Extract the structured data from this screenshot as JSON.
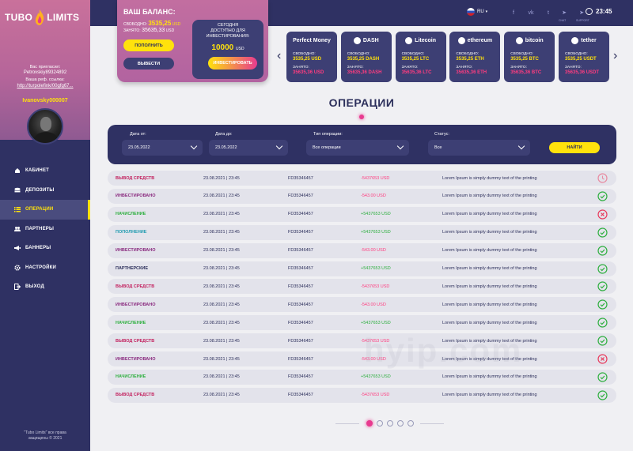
{
  "brand": {
    "name_left": "TUBO",
    "name_right": "LIMITS"
  },
  "colors": {
    "sidebar": "#2f3163",
    "accent_yellow": "#ffe20c",
    "accent_pink": "#e83a8f",
    "positive": "#2eaf3f",
    "negative": "#ff3c7f",
    "card": "#3d3f74"
  },
  "sidebar": {
    "invite_label": "Вас пригласил:",
    "inviter": "Petrovskiy89324892",
    "ref_label": "Ваша реф. ссылка:",
    "ref_link": "http://turpolefink/00gfg67...",
    "username": "Ivanovsky000007",
    "menu": [
      {
        "label": "КАБИНЕТ",
        "icon": "home-icon",
        "active": false
      },
      {
        "label": "ДЕПОЗИТЫ",
        "icon": "coins-icon",
        "active": false
      },
      {
        "label": "ОПЕРАЦИИ",
        "icon": "list-icon",
        "active": true
      },
      {
        "label": "ПАРТНЕРЫ",
        "icon": "users-icon",
        "active": false
      },
      {
        "label": "БАННЕРЫ",
        "icon": "megaphone-icon",
        "active": false
      },
      {
        "label": "НАСТРОЙКИ",
        "icon": "gear-icon",
        "active": false
      },
      {
        "label": "ВЫХОД",
        "icon": "logout-icon",
        "active": false
      }
    ],
    "copyright_1": "\"Tubo Limits\" все права",
    "copyright_2": "защищены © 2021"
  },
  "balance": {
    "title": "ВАШ БАЛАНС:",
    "free_label": "СВОБОДНО:",
    "free_value": "3535,25",
    "free_unit": "USD",
    "busy_label": "ЗАНЯТО:",
    "busy_value": "35635,33",
    "busy_unit": "USD",
    "topup_label": "ПОПОЛНИТЬ",
    "withdraw_label": "ВЫВЕСТИ",
    "invest_text_1": "СЕГОДНЯ",
    "invest_text_2": "ДОСТУПНО ДЛЯ",
    "invest_text_3": "ИНВЕСТИРОВАНИЯ:",
    "invest_value": "10000",
    "invest_unit": "USD",
    "invest_button": "ИНВЕСТИРОВАТЬ"
  },
  "topbar": {
    "lang": "RU",
    "social": [
      {
        "icon": "facebook-icon",
        "glyph": "f",
        "label": ""
      },
      {
        "icon": "vk-icon",
        "glyph": "vk",
        "label": ""
      },
      {
        "icon": "twitter-icon",
        "glyph": "t",
        "label": ""
      },
      {
        "icon": "telegram-chat-icon",
        "glyph": "➤",
        "label": "CHAT"
      },
      {
        "icon": "telegram-support-icon",
        "glyph": "➤",
        "label": "SUPPORT"
      }
    ],
    "time": "23:45"
  },
  "wallets": [
    {
      "name": "Perfect Money",
      "free_label": "СВОБОДНО:",
      "free": "3535,25 USD",
      "busy_label": "ЗАНЯТО:",
      "busy": "35635,36 USD"
    },
    {
      "name": "DASH",
      "free_label": "СВОБОДНО:",
      "free": "3535,25 DASH",
      "busy_label": "ЗАНЯТО:",
      "busy": "35635,36 DASH"
    },
    {
      "name": "Litecoin",
      "free_label": "СВОБОДНО:",
      "free": "3535,25 LTC",
      "busy_label": "ЗАНЯТО:",
      "busy": "35635,36 LTC"
    },
    {
      "name": "ethereum",
      "free_label": "СВОБОДНО:",
      "free": "3535,25 ETH",
      "busy_label": "ЗАНЯТО:",
      "busy": "35635,36 ETH"
    },
    {
      "name": "bitcoin",
      "free_label": "СВОБОДНО:",
      "free": "3535,25 BTC",
      "busy_label": "ЗАНЯТО:",
      "busy": "35635,36 BTC"
    },
    {
      "name": "tether",
      "free_label": "СВОБОДНО:",
      "free": "3535,25 USDT",
      "busy_label": "ЗАНЯТО:",
      "busy": "35635,36 USDT"
    }
  ],
  "page_title": "ОПЕРАЦИИ",
  "filters": {
    "date_from_label": "Дата от:",
    "date_from": "23.05.2022",
    "date_to_label": "Дата до:",
    "date_to": "23.05.2022",
    "type_label": "Тип операции:",
    "type_value": "Все операции",
    "status_label": "Статус:",
    "status_value": "Все",
    "find_button": "НАЙТИ"
  },
  "operations": [
    {
      "type": "ВЫВОД СРЕДСТВ",
      "kind": "withdraw",
      "date": "23.08.2021 | 23:45",
      "id": "FD35346457",
      "amount": "-5437653 USD",
      "sign": "neg",
      "desc": "Lorem Ipsum is simply dummy text of the printing",
      "status": "pending"
    },
    {
      "type": "ИНВЕСТИРОВАНО",
      "kind": "invest",
      "date": "23.08.2021 | 23:45",
      "id": "FD35346457",
      "amount": "-543.00 USD",
      "sign": "neg",
      "desc": "Lorem Ipsum is simply dummy text of the printing",
      "status": "ok"
    },
    {
      "type": "НАЧИСЛЕНИЕ",
      "kind": "accrual",
      "date": "23.08.2021 | 23:45",
      "id": "FD35346457",
      "amount": "+5437653 USD",
      "sign": "pos",
      "desc": "Lorem Ipsum is simply dummy text of the printing",
      "status": "fail"
    },
    {
      "type": "ПОПОЛНЕНИЕ",
      "kind": "topup",
      "date": "23.08.2021 | 23:45",
      "id": "FD35346457",
      "amount": "+5437653 USD",
      "sign": "pos",
      "desc": "Lorem Ipsum is simply dummy text of the printing",
      "status": "ok"
    },
    {
      "type": "ИНВЕСТИРОВАНО",
      "kind": "invest",
      "date": "23.08.2021 | 23:45",
      "id": "FD35346457",
      "amount": "-543.00 USD",
      "sign": "neg",
      "desc": "Lorem Ipsum is simply dummy text of the printing",
      "status": "ok"
    },
    {
      "type": "ПАРТНЕРСКИЕ",
      "kind": "partner",
      "date": "23.08.2021 | 23:45",
      "id": "FD35346457",
      "amount": "+5437653 USD",
      "sign": "pos",
      "desc": "Lorem Ipsum is simply dummy text of the printing",
      "status": "ok"
    },
    {
      "type": "ВЫВОД СРЕДСТВ",
      "kind": "withdraw",
      "date": "23.08.2021 | 23:45",
      "id": "FD35346457",
      "amount": "-5437653 USD",
      "sign": "neg",
      "desc": "Lorem Ipsum is simply dummy text of the printing",
      "status": "ok"
    },
    {
      "type": "ИНВЕСТИРОВАНО",
      "kind": "invest",
      "date": "23.08.2021 | 23:45",
      "id": "FD35346457",
      "amount": "-543.00 USD",
      "sign": "neg",
      "desc": "Lorem Ipsum is simply dummy text of the printing",
      "status": "ok"
    },
    {
      "type": "НАЧИСЛЕНИЕ",
      "kind": "accrual",
      "date": "23.08.2021 | 23:45",
      "id": "FD35346457",
      "amount": "+5437653 USD",
      "sign": "pos",
      "desc": "Lorem Ipsum is simply dummy text of the printing",
      "status": "ok"
    },
    {
      "type": "ВЫВОД СРЕДСТВ",
      "kind": "withdraw",
      "date": "23.08.2021 | 23:45",
      "id": "FD35346457",
      "amount": "-5437653 USD",
      "sign": "neg",
      "desc": "Lorem Ipsum is simply dummy text of the printing",
      "status": "ok"
    },
    {
      "type": "ИНВЕСТИРОВАНО",
      "kind": "invest",
      "date": "23.08.2021 | 23:45",
      "id": "FD35346457",
      "amount": "-543.00 USD",
      "sign": "neg",
      "desc": "Lorem Ipsum is simply dummy text of the printing",
      "status": "fail"
    },
    {
      "type": "НАЧИСЛЕНИЕ",
      "kind": "accrual",
      "date": "23.08.2021 | 23:45",
      "id": "FD35346457",
      "amount": "+5437653 USD",
      "sign": "pos",
      "desc": "Lorem Ipsum is simply dummy text of the printing",
      "status": "ok"
    },
    {
      "type": "ВЫВОД СРЕДСТВ",
      "kind": "withdraw",
      "date": "23.08.2021 | 23:45",
      "id": "FD35346457",
      "amount": "-5437653 USD",
      "sign": "neg",
      "desc": "Lorem Ipsum is simply dummy text of the printing",
      "status": "ok"
    }
  ],
  "pagination": {
    "pages": 5,
    "current": 1
  }
}
